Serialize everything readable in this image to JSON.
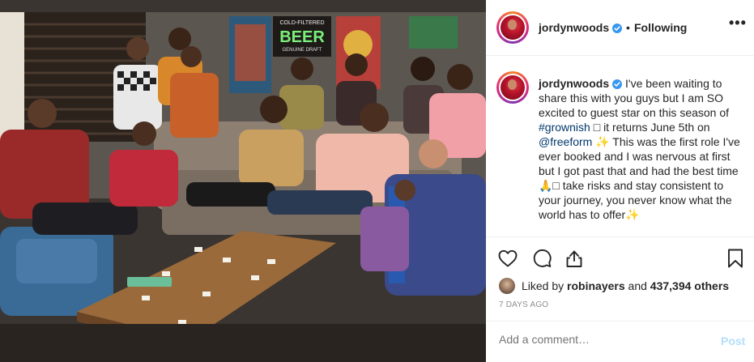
{
  "post": {
    "username": "jordynwoods",
    "verified": true,
    "follow_dot": "•",
    "follow_status": "Following",
    "more_label": "•••",
    "caption": {
      "username": "jordynwoods",
      "text_1": " I've been waiting to share this with you guys but I am SO excited to guest star on this season of ",
      "hashtag": "#grownish",
      "text_2": " □ it returns June 5th on ",
      "mention": "@freeform",
      "sparkle_1": " ✨",
      "text_3": " This was the first role I've ever booked and I was nervous at first but I got past that and had the best time",
      "text_4": "🙏□ take risks and stay consistent to your journey, you never know what the world has to offer",
      "sparkle_2": "✨"
    },
    "likes": {
      "prefix": "Liked by ",
      "user": "robinayers",
      "middle": " and ",
      "count": "437,394 others"
    },
    "timestamp": "7 DAYS AGO",
    "comment": {
      "placeholder": "Add a comment…",
      "post_label": "Post"
    }
  },
  "photo": {
    "sign_top": "COLD-FILTERED",
    "sign_main": "BEER",
    "sign_bottom": "GENUINE DRAFT"
  },
  "colors": {
    "link": "#00376b",
    "verified": "#3897f0",
    "post_disabled": "#b2dffc",
    "muted": "#8e8e8e"
  },
  "icons": [
    "verified-badge-icon",
    "more-options-icon",
    "heart-icon",
    "comment-icon",
    "share-icon",
    "bookmark-icon"
  ]
}
